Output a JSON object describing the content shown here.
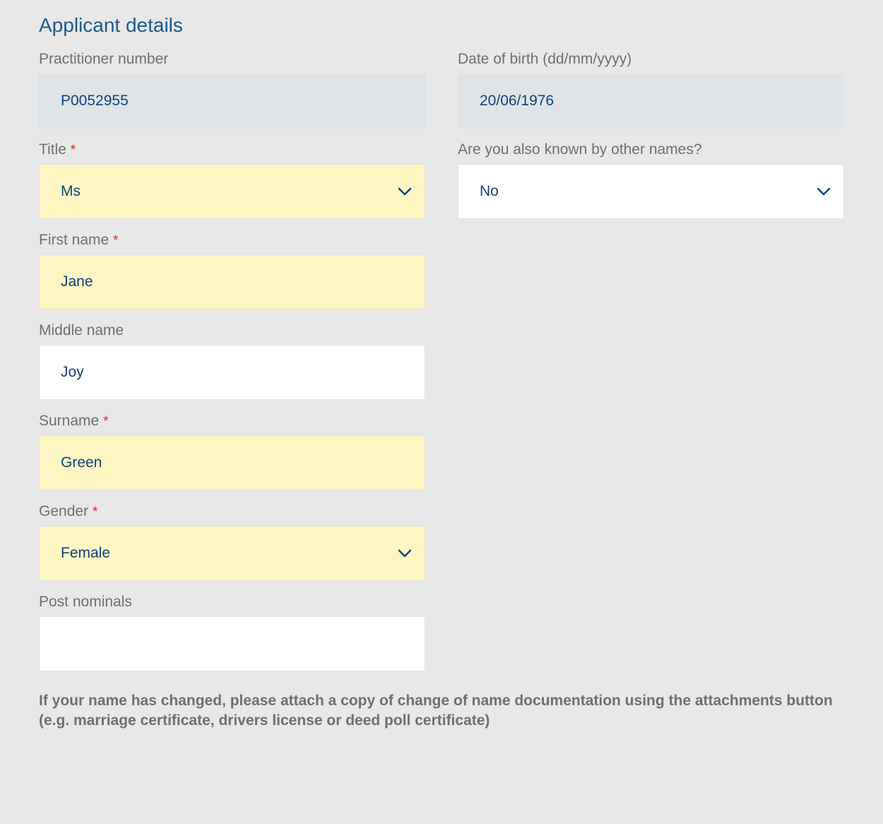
{
  "section": {
    "title": "Applicant details"
  },
  "labels": {
    "practitioner_number": "Practitioner number",
    "dob": "Date of birth (dd/mm/yyyy)",
    "title": "Title",
    "other_names": "Are you also known by other names?",
    "first_name": "First name",
    "middle_name": "Middle name",
    "surname": "Surname",
    "gender": "Gender",
    "post_nominals": "Post nominals",
    "required_mark": "*"
  },
  "values": {
    "practitioner_number": "P0052955",
    "dob": "20/06/1976",
    "title": "Ms",
    "other_names": "No",
    "first_name": "Jane",
    "middle_name": "Joy",
    "surname": "Green",
    "gender": "Female",
    "post_nominals": ""
  },
  "note": "If your name has changed, please attach a copy of change of name documentation using the attachments button (e.g. marriage certificate, drivers license or deed poll certificate)"
}
